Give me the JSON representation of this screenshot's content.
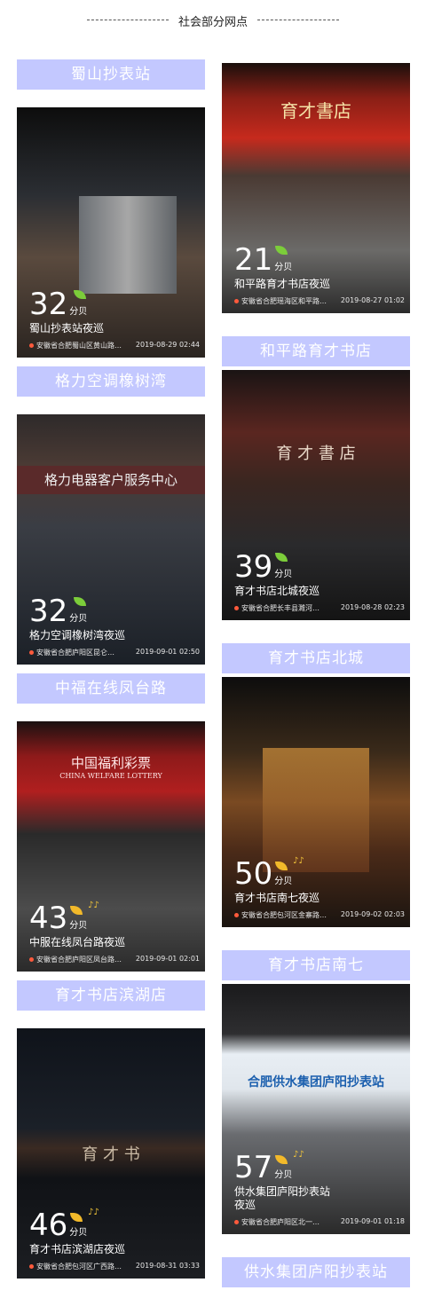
{
  "header": {
    "title": "社会部分网点"
  },
  "left": [
    {
      "label": "蜀山抄表站",
      "db": "32",
      "unit": "分贝",
      "desc": "蜀山抄表站夜巡",
      "location": "安徽省合肥蜀山区黄山路…",
      "datetime": "2019-08-29 02:44",
      "icon": "leaf-green"
    },
    {
      "label": "格力空调橡树湾",
      "db": "32",
      "unit": "分贝",
      "desc": "格力空调橡树湾夜巡",
      "location": "安徽省合肥庐阳区昆仑…",
      "datetime": "2019-09-01 02:50",
      "icon": "leaf-green",
      "sign": "格力电器客户服务中心"
    },
    {
      "label": "中福在线凤台路",
      "db": "43",
      "unit": "分贝",
      "desc": "中服在线凤台路夜巡",
      "location": "安徽省合肥庐阳区凤台路…",
      "datetime": "2019-09-01 02:01",
      "icon": "leaf-yellow",
      "sign": "中国福利彩票",
      "sign_en": "CHINA WELFARE LOTTERY"
    },
    {
      "label": "育才书店滨湖店",
      "db": "46",
      "unit": "分贝",
      "desc": "育才书店滨湖店夜巡",
      "location": "安徽省合肥包河区广西路…",
      "datetime": "2019-08-31 03:33",
      "icon": "leaf-yellow",
      "sign": "育 才 书"
    }
  ],
  "right": [
    {
      "label": null,
      "db": "21",
      "unit": "分贝",
      "desc": "和平路育才书店夜巡",
      "location": "安徽省合肥瑶海区和平路…",
      "datetime": "2019-08-27 01:02",
      "icon": "leaf-green",
      "sign": "育才書店"
    },
    {
      "label": "和平路育才书店",
      "db": "39",
      "unit": "分贝",
      "desc": "育才书店北城夜巡",
      "location": "安徽省合肥长丰县濉河…",
      "datetime": "2019-08-28 02:23",
      "icon": "leaf-green",
      "sign": "育 才 書 店"
    },
    {
      "label": "育才书店北城",
      "db": "50",
      "unit": "分贝",
      "desc": "育才书店南七夜巡",
      "location": "安徽省合肥包河区金寨路…",
      "datetime": "2019-09-02 02:03",
      "icon": "leaf-yellow"
    },
    {
      "label": "育才书店南七",
      "db": "57",
      "unit": "分贝",
      "desc": "供水集团庐阳抄表站夜巡",
      "location": "安徽省合肥庐阳区北一…",
      "datetime": "2019-09-01 01:18",
      "icon": "leaf-yellow",
      "sign": "合肥供水集团庐阳抄表站"
    },
    {
      "label": "供水集团庐阳抄表站"
    }
  ]
}
